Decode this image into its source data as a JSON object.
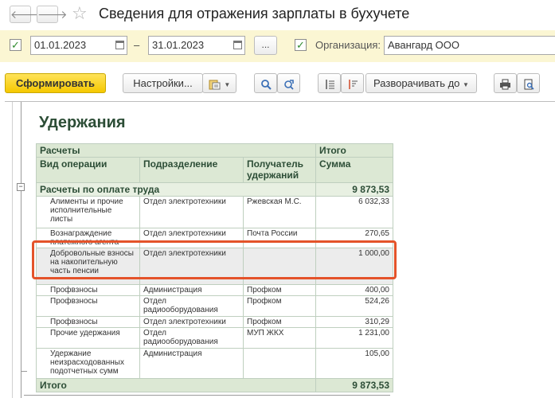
{
  "window": {
    "title": "Сведения для отражения зарплаты в бухучете",
    "back_icon": "arrow-left-icon",
    "forward_icon": "arrow-right-icon",
    "favorite_icon": "star-icon"
  },
  "filters": {
    "period_enabled": "✓",
    "date_from": "01.01.2023",
    "dash": "–",
    "date_to": "31.01.2023",
    "period_button": "...",
    "org_enabled": "✓",
    "org_label": "Организация:",
    "org_value": "Авангард ООО"
  },
  "toolbar": {
    "generate": "Сформировать",
    "settings": "Настройки...",
    "expand": "Разворачивать до"
  },
  "report": {
    "heading": "Удержания",
    "header": {
      "group_calc": "Расчеты",
      "group_total": "Итого",
      "col_op": "Вид операции",
      "col_dept": "Подразделение",
      "col_recipient": "Получатель удержаний",
      "col_sum": "Сумма"
    },
    "group": {
      "label": "Расчеты по оплате труда",
      "sum": "9 873,53"
    },
    "rows": [
      {
        "op": "Алименты и прочие исполнительные листы",
        "dept": "Отдел электротехники",
        "recipient": "Ржевская М.С.",
        "sum": "6 032,33"
      },
      {
        "op": "Вознаграждение платежного агента",
        "dept": "Отдел электротехники",
        "recipient": "Почта России",
        "sum": "270,65"
      },
      {
        "op": "Добровольные взносы на накопительную часть пенсии",
        "dept": "Отдел электротехники",
        "recipient": "",
        "sum": "1 000,00"
      },
      {
        "op": "Профвзносы",
        "dept": "Администрация",
        "recipient": "Профком",
        "sum": "400,00"
      },
      {
        "op": "Профвзносы",
        "dept": "Отдел радиооборудования",
        "recipient": "Профком",
        "sum": "524,26"
      },
      {
        "op": "Профвзносы",
        "dept": "Отдел электротехники",
        "recipient": "Профком",
        "sum": "310,29"
      },
      {
        "op": "Прочие удержания",
        "dept": "Отдел радиооборудования",
        "recipient": "МУП ЖКХ",
        "sum": "1 231,00"
      },
      {
        "op": "Удержание неизрасходованных подотчетных сумм",
        "dept": "Администрация",
        "recipient": "",
        "sum": "105,00"
      }
    ],
    "total": {
      "label": "Итого",
      "sum": "9 873,53"
    }
  },
  "colors": {
    "accent_yellow": "#f5c800",
    "highlight": "#e4532a",
    "header_green": "#dce8d4"
  }
}
